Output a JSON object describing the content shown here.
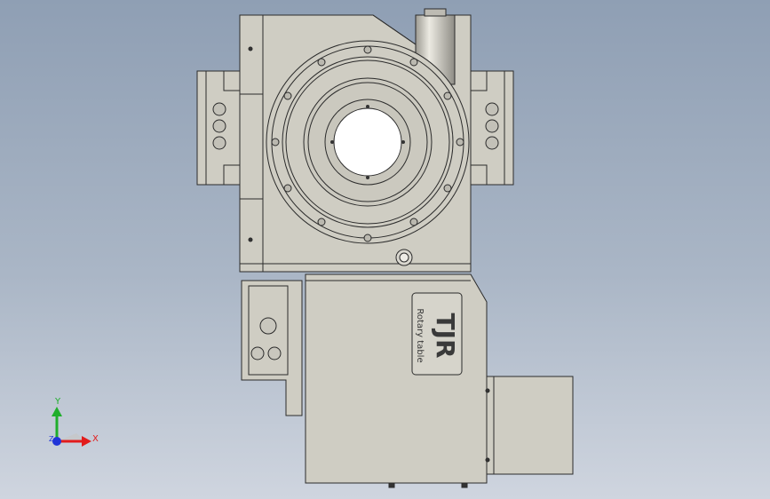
{
  "viewport": {
    "background_top": "#8f9fb4",
    "background_bottom": "#cfd5df"
  },
  "model": {
    "name": "TJR rotary table",
    "logo_text": "TJR",
    "logo_subtitle": "Rotary table",
    "body_color": "#cfcdc3",
    "edge_color": "#2b2b2b"
  },
  "triad": {
    "x_label": "X",
    "y_label": "Y",
    "z_label": "Z",
    "x_color": "#e21c1c",
    "y_color": "#1fae2b",
    "z_color": "#2035d8"
  }
}
